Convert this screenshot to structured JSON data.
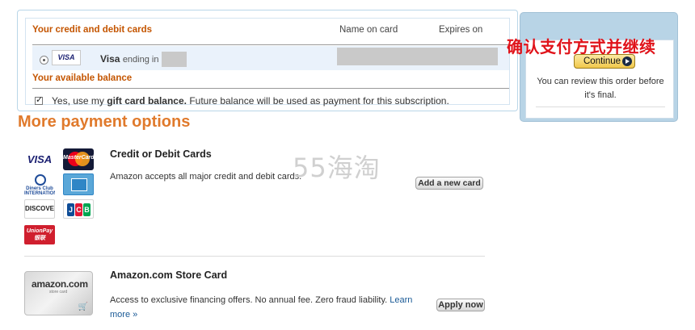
{
  "selection": {
    "cards_header": "Your credit and debit cards",
    "name_header": "Name on card",
    "expires_header": "Expires on",
    "card": {
      "logo": "VISA",
      "brand": "Visa",
      "ending_label": "ending in"
    },
    "balance_header": "Your available balance",
    "gift_prefix": "Yes, use my",
    "gift_bold": "gift card balance.",
    "gift_suffix": "Future balance will be used as payment for this subscription."
  },
  "continue_panel": {
    "annotation": "确认支付方式并继续",
    "button_label": "Continue",
    "review_text": "You can review this order before it's final."
  },
  "more_options": {
    "title": "More payment options",
    "credit_cards": {
      "title": "Credit or Debit Cards",
      "description": "Amazon accepts all major credit and debit cards.",
      "button": "Add a new card",
      "logos": {
        "visa": "VISA",
        "mastercard": "MasterCard",
        "diners": "Diners Club INTERNATIONAL",
        "discover": "DISCOVER",
        "jcb": [
          "J",
          "C",
          "B"
        ],
        "unionpay": "UnionPay 银联"
      }
    },
    "store_card": {
      "title": "Amazon.com Store Card",
      "description": "Access to exclusive financing offers. No annual fee. Zero fraud liability.",
      "learn_more": "Learn more »",
      "button": "Apply now",
      "card_brand": "amazon.com",
      "card_sub": "store card"
    }
  },
  "watermark": "55海淘",
  "colors": {
    "orange_heading": "#e07a2c",
    "section_header": "#c45500",
    "annotation_red": "#e0131a",
    "link_blue": "#1a5a96"
  }
}
